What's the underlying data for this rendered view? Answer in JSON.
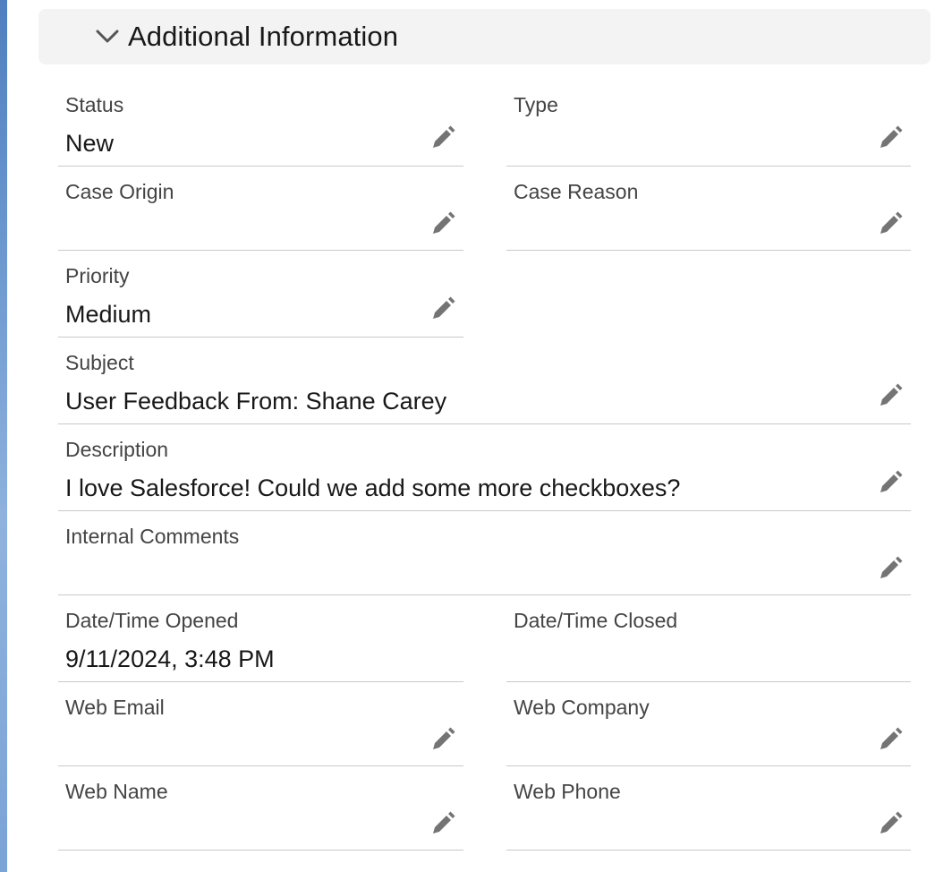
{
  "section": {
    "title": "Additional Information",
    "collapse_icon": "chevron-down-icon"
  },
  "fields": {
    "status": {
      "label": "Status",
      "value": "New"
    },
    "type": {
      "label": "Type",
      "value": ""
    },
    "case_origin": {
      "label": "Case Origin",
      "value": ""
    },
    "case_reason": {
      "label": "Case Reason",
      "value": ""
    },
    "priority": {
      "label": "Priority",
      "value": "Medium"
    },
    "subject": {
      "label": "Subject",
      "value": "User Feedback From: Shane Carey"
    },
    "description": {
      "label": "Description",
      "value": "I love Salesforce! Could we add some more checkboxes?"
    },
    "internal_comments": {
      "label": "Internal Comments",
      "value": ""
    },
    "datetime_opened": {
      "label": "Date/Time Opened",
      "value": "9/11/2024, 3:48 PM"
    },
    "datetime_closed": {
      "label": "Date/Time Closed",
      "value": ""
    },
    "web_email": {
      "label": "Web Email",
      "value": ""
    },
    "web_company": {
      "label": "Web Company",
      "value": ""
    },
    "web_name": {
      "label": "Web Name",
      "value": ""
    },
    "web_phone": {
      "label": "Web Phone",
      "value": ""
    }
  },
  "icons": {
    "edit": "pencil-icon"
  },
  "colors": {
    "header_bg": "#f3f3f3",
    "label": "#444444",
    "value": "#181818",
    "divider": "#c9c9c9",
    "icon": "#747474"
  }
}
